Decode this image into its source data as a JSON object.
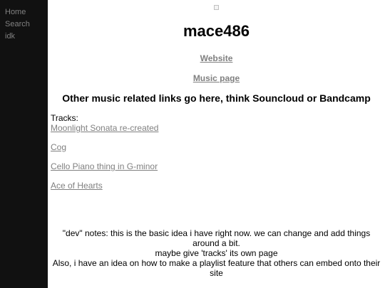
{
  "sidebar": {
    "items": [
      {
        "label": "Home"
      },
      {
        "label": "Search"
      },
      {
        "label": "idk"
      }
    ]
  },
  "header": {
    "title": "mace486"
  },
  "links": {
    "website": "Website",
    "music_page": "Music page"
  },
  "subheading": "Other music related links go here, think Souncloud or Bandcamp",
  "tracks": {
    "label": "Tracks:",
    "items": [
      "Moonlight Sonata re-created",
      "Cog",
      "Cello Piano thing in G-minor",
      "Ace of Hearts"
    ]
  },
  "dev_notes": {
    "line1": "\"dev\" notes: this is the basic idea i have right now. we can change and add things around a bit.",
    "line2": "maybe give 'tracks' its own page",
    "line3": "Also, i have an idea on how to make a playlist feature that others can embed onto their site"
  },
  "colors": {
    "sidebar_bg": "#111111",
    "sidebar_text": "#818181",
    "link": "#808080"
  }
}
